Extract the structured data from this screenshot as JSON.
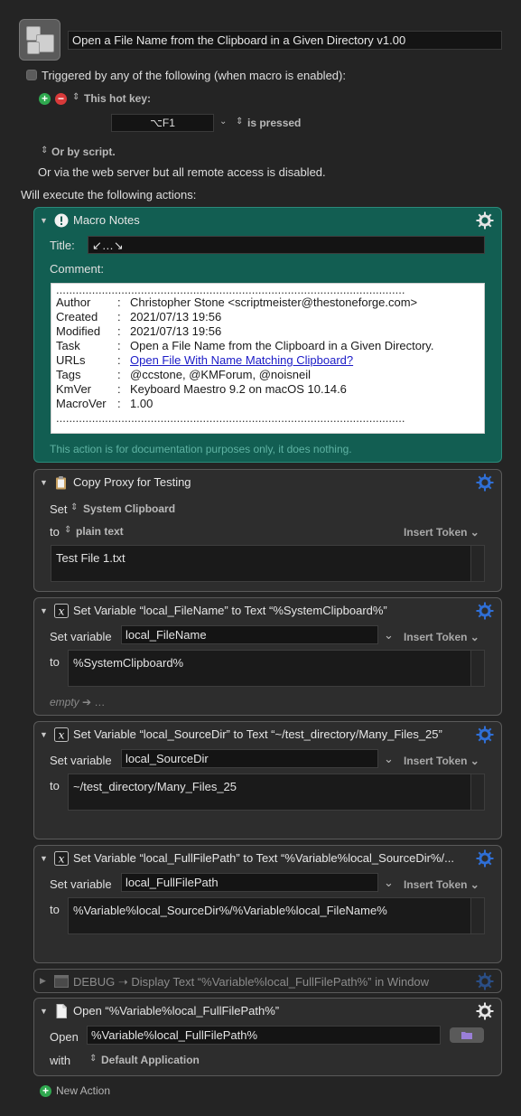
{
  "macro": {
    "name": "Open a File Name from the Clipboard in a Given Directory v1.00",
    "triggered_label": "Triggered by any of the following (when macro is enabled):",
    "hotkey_label": "This hot key:",
    "hotkey_value": "⌥F1",
    "hotkey_state": "is pressed",
    "or_by_script": "Or by script.",
    "web_server": "Or via the web server but all remote access is disabled.",
    "will_execute": "Will execute the following actions:"
  },
  "notes_action": {
    "title": "Macro Notes",
    "title_label": "Title:",
    "title_value": "↙…↘",
    "comment_label": "Comment:",
    "rows": [
      {
        "key": "Author",
        "value": "Christopher Stone <scriptmeister@thestoneforge.com>"
      },
      {
        "key": "Created",
        "value": "2021/07/13 19:56"
      },
      {
        "key": "Modified",
        "value": "2021/07/13 19:56"
      },
      {
        "key": "Task",
        "value": "Open a File Name from the Clipboard in a Given Directory."
      },
      {
        "key": "URLs",
        "value": "Open File With Name Matching Clipboard?"
      },
      {
        "key": "Tags",
        "value": "@ccstone, @KMForum, @noisneil"
      },
      {
        "key": "KmVer",
        "value": "Keyboard Maestro 9.2 on macOS 10.14.6"
      },
      {
        "key": "MacroVer",
        "value": "1.00"
      }
    ],
    "separator": "...........................................................................................................",
    "footer": "This action is for documentation purposes only, it does nothing."
  },
  "copy_action": {
    "title": "Copy Proxy for Testing",
    "set_label": "Set",
    "clipboard": "System Clipboard",
    "to_label": "to",
    "format": "plain text",
    "insert_token": "Insert Token",
    "text": "Test File 1.txt"
  },
  "var_actions": [
    {
      "title": "Set Variable “local_FileName” to Text “%SystemClipboard%”",
      "set_label": "Set variable",
      "var": "local_FileName",
      "insert_token": "Insert Token",
      "to_label": "to",
      "text": "%SystemClipboard%",
      "empty": "empty",
      "empty_tail": "…"
    },
    {
      "title": "Set Variable “local_SourceDir” to Text “~/test_directory/Many_Files_25”",
      "set_label": "Set variable",
      "var": "local_SourceDir",
      "insert_token": "Insert Token",
      "to_label": "to",
      "text": "~/test_directory/Many_Files_25"
    },
    {
      "title": "Set Variable “local_FullFilePath” to Text “%Variable%local_SourceDir%/...",
      "set_label": "Set variable",
      "var": "local_FullFilePath",
      "insert_token": "Insert Token",
      "to_label": "to",
      "text": "%Variable%local_SourceDir%/%Variable%local_FileName%"
    }
  ],
  "debug_action": {
    "title": "DEBUG ➝ Display Text “%Variable%local_FullFilePath%” in Window"
  },
  "open_action": {
    "title": "Open “%Variable%local_FullFilePath%”",
    "open_label": "Open",
    "path": "%Variable%local_FullFilePath%",
    "with_label": "with",
    "app": "Default Application"
  },
  "new_action": "New Action",
  "colors": {
    "notes_bg": "#125e52",
    "gear_blue": "#2f6fd6",
    "plus_green": "#2fa84f",
    "minus_red": "#d83a3a"
  }
}
